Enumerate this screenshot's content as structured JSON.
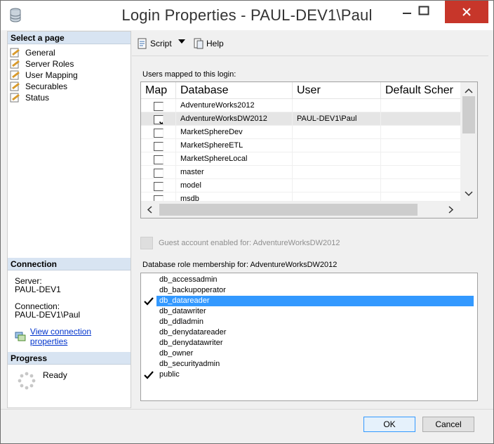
{
  "window": {
    "title": "Login Properties - PAUL-DEV1\\Paul"
  },
  "left": {
    "select_page_heading": "Select a page",
    "pages": [
      {
        "label": "General"
      },
      {
        "label": "Server Roles"
      },
      {
        "label": "User Mapping"
      },
      {
        "label": "Securables"
      },
      {
        "label": "Status"
      }
    ],
    "connection_heading": "Connection",
    "server_label": "Server:",
    "server_value": "PAUL-DEV1",
    "connection_label": "Connection:",
    "connection_value": "PAUL-DEV1\\Paul",
    "view_link": "View connection properties",
    "progress_heading": "Progress",
    "progress_status": "Ready"
  },
  "toolbar": {
    "script_label": "Script",
    "help_label": "Help"
  },
  "mapping": {
    "label": "Users mapped to this login:",
    "columns": [
      "Map",
      "Database",
      "User",
      "Default Scher"
    ],
    "rows": [
      {
        "map": false,
        "database": "AdventureWorks2012",
        "user": ""
      },
      {
        "map": true,
        "database": "AdventureWorksDW2012",
        "user": "PAUL-DEV1\\Paul"
      },
      {
        "map": false,
        "database": "MarketSphereDev",
        "user": ""
      },
      {
        "map": false,
        "database": "MarketSphereETL",
        "user": ""
      },
      {
        "map": false,
        "database": "MarketSphereLocal",
        "user": ""
      },
      {
        "map": false,
        "database": "master",
        "user": ""
      },
      {
        "map": false,
        "database": "model",
        "user": ""
      },
      {
        "map": false,
        "database": "msdb",
        "user": ""
      }
    ]
  },
  "guest": {
    "label": "Guest account enabled for: AdventureWorksDW2012"
  },
  "roles": {
    "label": "Database role membership for: AdventureWorksDW2012",
    "items": [
      {
        "name": "db_accessadmin",
        "checked": false
      },
      {
        "name": "db_backupoperator",
        "checked": false
      },
      {
        "name": "db_datareader",
        "checked": true
      },
      {
        "name": "db_datawriter",
        "checked": false
      },
      {
        "name": "db_ddladmin",
        "checked": false
      },
      {
        "name": "db_denydatareader",
        "checked": false
      },
      {
        "name": "db_denydatawriter",
        "checked": false
      },
      {
        "name": "db_owner",
        "checked": false
      },
      {
        "name": "db_securityadmin",
        "checked": false
      },
      {
        "name": "public",
        "checked": true
      }
    ]
  },
  "buttons": {
    "ok": "OK",
    "cancel": "Cancel"
  }
}
